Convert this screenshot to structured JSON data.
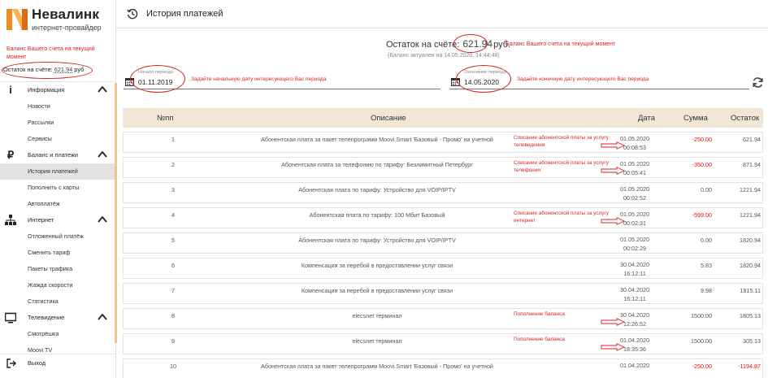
{
  "brand": {
    "name": "Невалинк",
    "tagline": "интернет-провайдер",
    "accent_color": "#f08c1e"
  },
  "sidebar": {
    "balance_note": "Баланс Вашего счета на текущий момент",
    "balance_label": "Остаток на счёте:",
    "balance_amount": "621.94",
    "balance_currency": "руб",
    "groups": [
      {
        "label": "Информация",
        "icon": "info-icon",
        "items": [
          "Новости",
          "Рассылки",
          "Сервисы"
        ]
      },
      {
        "label": "Баланс и платежи",
        "icon": "ruble-icon",
        "items": [
          "История платежей",
          "Пополнить с карты",
          "Автоплатёж"
        ]
      },
      {
        "label": "Интернет",
        "icon": "network-icon",
        "items": [
          "Отложенный платёж",
          "Сменить тариф",
          "Пакеты трафика",
          "Жажда скорости",
          "Статистика"
        ]
      },
      {
        "label": "Телевидение",
        "icon": "tv-icon",
        "items": [
          "Смотрёшка",
          "Moovi TV"
        ]
      }
    ],
    "active_item": "История платежей",
    "logout": "Выход"
  },
  "topbar": {
    "title": "История платежей",
    "icon": "history-icon"
  },
  "balance": {
    "label": "Остаток на счёте:",
    "amount": "621.94",
    "currency": "руб.",
    "note": "Баланс Вашего счета на текущий момент",
    "updated": "(Баланс актуален на 14.05.2020, 14:44:48)"
  },
  "period": {
    "start_label": "Начало периода",
    "start_value": "01.11.2019",
    "start_hint": "Задайте начальную дату интересующего Вас периода",
    "end_label": "Окончание периода",
    "end_value": "14.05.2020",
    "end_hint": "Задайте конечную дату интересующего Вас периода"
  },
  "table": {
    "headers": {
      "num": "№пп",
      "desc": "Описание",
      "date": "Дата",
      "sum": "Сумма",
      "rest": "Остаток"
    },
    "rows": [
      {
        "num": "1",
        "desc": "Абонентская плата за пакет телепрограмм Moovi.Smart 'Базовый - Промо' на учетной",
        "date": "01.05.2020",
        "time": "00:08:53",
        "sum": "-250.00",
        "rest": "621.94",
        "negative": true
      },
      {
        "num": "2",
        "desc": "Абонентская плата за телефонию по тарифу: Безлимитный Петербург",
        "date": "01.05.2020",
        "time": "00:05:41",
        "sum": "-350.00",
        "rest": "871.94",
        "negative": true
      },
      {
        "num": "3",
        "desc": "Абонентская плата по тарифу: Устройство для VOIP/IPTV",
        "date": "01.05.2020",
        "time": "00:02:52",
        "sum": "0.00",
        "rest": "1221.94",
        "negative": false
      },
      {
        "num": "4",
        "desc": "Абонентская плата по тарифу: 100 Мбит Базовый",
        "date": "01.05.2020",
        "time": "00:02:31",
        "sum": "-599.00",
        "rest": "1221.94",
        "negative": true
      },
      {
        "num": "5",
        "desc": "Абонентская плата по тарифу: Устройство для VOIP/IPTV",
        "date": "01.05.2020",
        "time": "00:02:29",
        "sum": "0.00",
        "rest": "1820.94",
        "negative": false
      },
      {
        "num": "6",
        "desc": "Компенсация за перебой в предоставлении услуг связи",
        "date": "30.04.2020",
        "time": "16:12:11",
        "sum": "5.83",
        "rest": "1820.94",
        "negative": false
      },
      {
        "num": "7",
        "desc": "Компенсация за перебой в предоставлении услуг связи",
        "date": "30.04.2020",
        "time": "16:12:11",
        "sum": "9.98",
        "rest": "1815.11",
        "negative": false
      },
      {
        "num": "8",
        "desc": "elecsnet терминал",
        "date": "30.04.2020",
        "time": "12:26:52",
        "sum": "1500.00",
        "rest": "1805.13",
        "negative": false
      },
      {
        "num": "9",
        "desc": "elecsnet терминал",
        "date": "01.04.2020",
        "time": "18:35:36",
        "sum": "1500.00",
        "rest": "305.13",
        "negative": false
      },
      {
        "num": "10",
        "desc": "Абонентская плата за пакет телепрограмм Moovi.Smart 'Базовый - Промо' на учетной",
        "date": "01.04.2020",
        "time": "",
        "sum": "-250.00",
        "rest": "-1194.87",
        "negative": true
      }
    ]
  },
  "annotations": [
    {
      "text": "Списание абонентской платы за услугу телевидения",
      "row": 0
    },
    {
      "text": "Списание абонентской платы за услугу телефонии",
      "row": 1
    },
    {
      "text": "Списание абонентской платы за услугу интернет",
      "row": 3
    },
    {
      "text": "Пополнение баланса",
      "row": 7
    },
    {
      "text": "Пополнение баланса",
      "row": 8
    }
  ],
  "colors": {
    "annotation_red": "#d22222",
    "negative_amount": "#e01010",
    "table_header_bg": "#f2e6d6",
    "active_nav_bg": "#e3e3e3"
  }
}
